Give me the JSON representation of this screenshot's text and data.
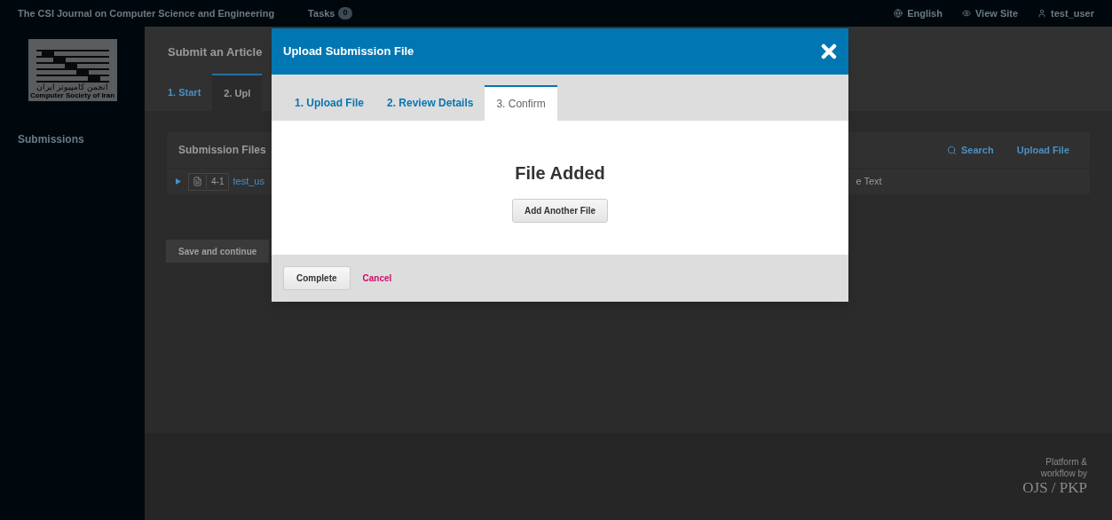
{
  "top_bar": {
    "site_title": "The CSI Journal on Computer Science and Engineering",
    "tasks": {
      "label": "Tasks",
      "count": "0"
    },
    "links": [
      {
        "label": "English"
      },
      {
        "label": "View Site"
      },
      {
        "label": "test_user"
      }
    ]
  },
  "sidebar": {
    "logo_text_fa": "انجمن کامپیوتر ایران",
    "logo_text_en": "Computer Society of Iran",
    "items": [
      {
        "label": "Submissions"
      }
    ]
  },
  "page": {
    "title": "Submit an Article",
    "steps": [
      {
        "label": "1. Start",
        "selected": false
      },
      {
        "label": "2. Upl",
        "selected": true
      }
    ],
    "files_panel": {
      "title": "Submission Files",
      "actions": [
        {
          "label": "Search"
        },
        {
          "label": "Upload File"
        }
      ],
      "rows": [
        {
          "id": "4-1",
          "name": "test_us",
          "column_3": "e Text"
        }
      ]
    },
    "save_button": "Save and continue"
  },
  "footer": {
    "line_1": "Platform &",
    "line_2": "workflow by",
    "brand": "OJS / PKP"
  },
  "modal": {
    "title": "Upload Submission File",
    "tabs": [
      {
        "label": "1. Upload File",
        "selected": false
      },
      {
        "label": "2. Review Details",
        "selected": false
      },
      {
        "label": "3. Confirm",
        "selected": true
      }
    ],
    "heading": "File Added",
    "body_button": "Add Another File",
    "primary_button": "Complete",
    "cancel_link": "Cancel"
  }
}
